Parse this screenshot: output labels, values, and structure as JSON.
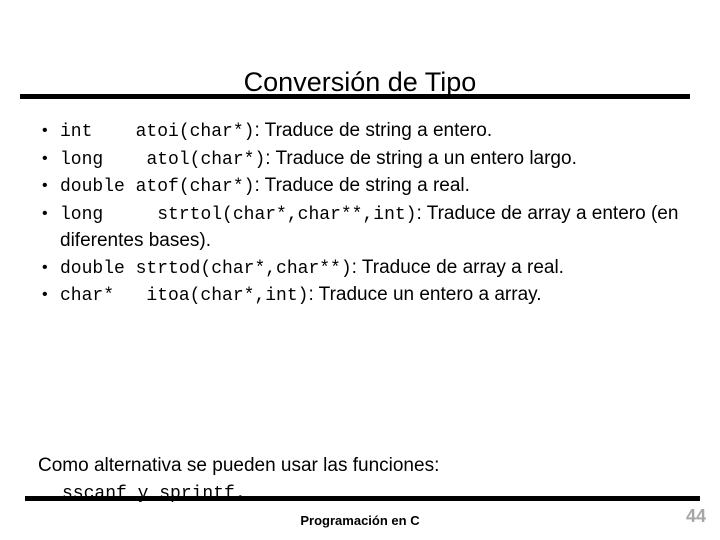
{
  "slide": {
    "title": "Conversión de Tipo",
    "bullet_char": "•",
    "items": [
      {
        "type": "int",
        "signature": "atoi(char*)",
        "separator": ": ",
        "description": "Traduce de string a entero.",
        "gap": "    "
      },
      {
        "type": "long",
        "signature": "atol(char*)",
        "separator": ": ",
        "description": "Traduce de string a un entero largo.",
        "gap": "    "
      },
      {
        "type": "double",
        "signature": "atof(char*)",
        "separator": ": ",
        "description": "Traduce de string a real.",
        "gap": " "
      },
      {
        "type": "long",
        "signature": "strtol(char*,char**,int)",
        "separator": ": ",
        "description": "Traduce de array a entero (en diferentes bases).",
        "gap": "     "
      },
      {
        "type": "double",
        "signature": "strtod(char*,char**)",
        "separator": ": ",
        "description": "Traduce de array a real.",
        "gap": " "
      },
      {
        "type": "char*",
        "signature": "itoa(char*,int)",
        "separator": ": ",
        "description": "Traduce un entero a array.",
        "gap": "   "
      }
    ],
    "closing": {
      "line1": "Como alternativa se pueden usar las funciones:",
      "line2": "sscanf y sprintf."
    }
  },
  "footer": {
    "center_label": "Programación en C",
    "page_number": "44"
  },
  "colors": {
    "text": "#000000",
    "background": "#ffffff",
    "rule": "#000000",
    "page_number": "#a6a6a6"
  }
}
